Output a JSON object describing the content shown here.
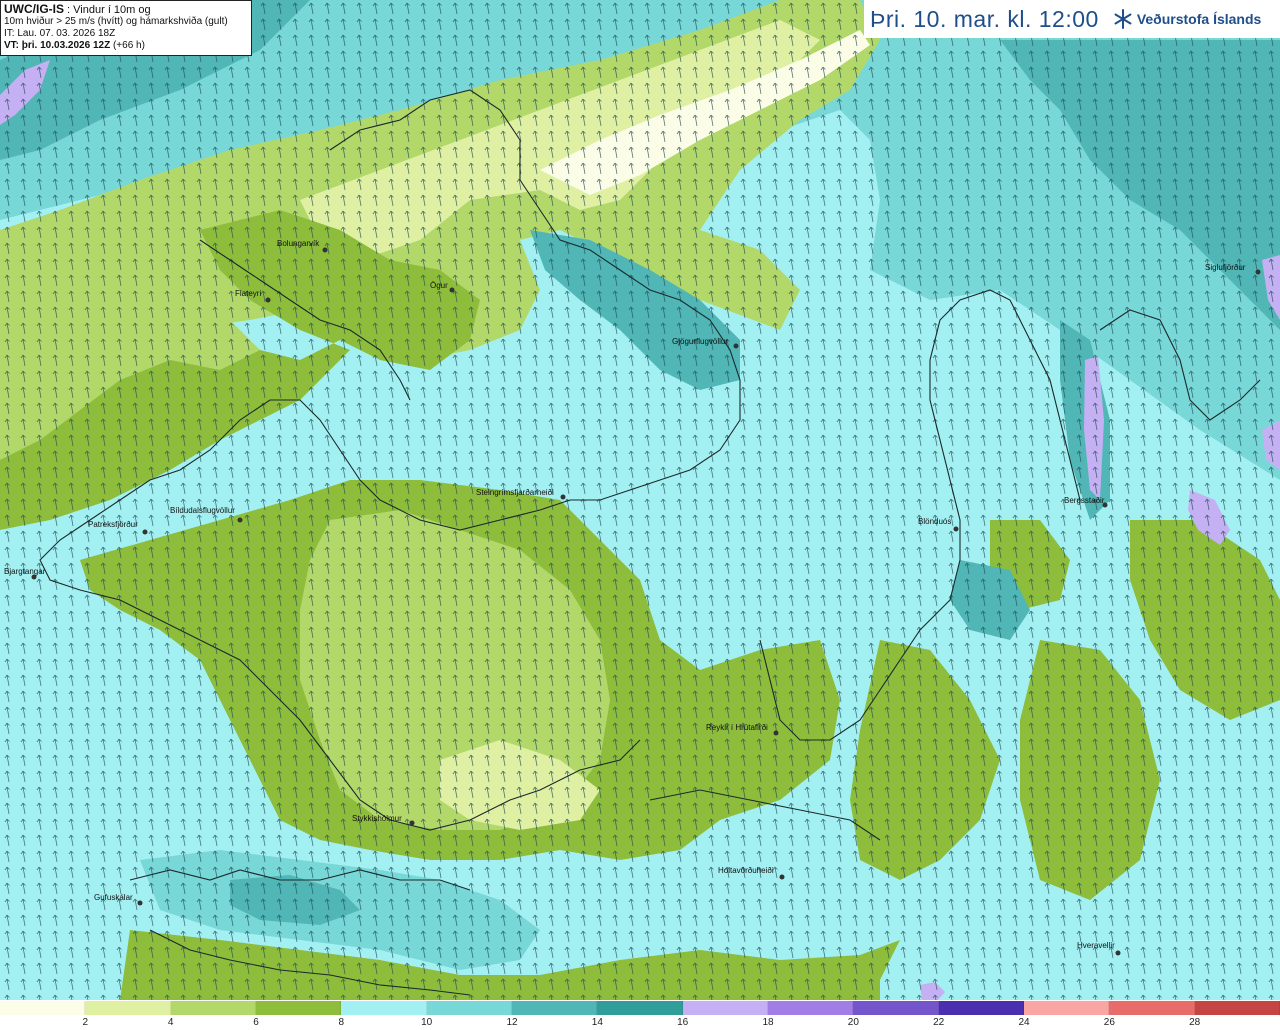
{
  "info": {
    "model": "UWC/IG-IS",
    "line1_rest": " : Vindur í 10m og",
    "line2": "10m hviður > 25 m/s (hvítt) og hámarkshviða (gult)",
    "line3": "IT: Lau. 07. 03. 2026 18Z",
    "line4_label": "VT:",
    "line4_value": "þri. 10.03.2026 12Z",
    "line4_offset": "(+66 h)"
  },
  "header": {
    "valid_time": "Þri. 10. mar. kl. 12:00",
    "logo_text": "Veðurstofa Íslands",
    "logo_icon": "snowflake-icon"
  },
  "legend": {
    "ticks": [
      "2",
      "4",
      "6",
      "8",
      "10",
      "12",
      "14",
      "16",
      "18",
      "20",
      "22",
      "24",
      "26",
      "28"
    ],
    "colors": [
      "#fbfde6",
      "#dff0a3",
      "#b3d86a",
      "#8dbd3a",
      "#a3f0f2",
      "#78d7d7",
      "#50b6b6",
      "#2f9d9a",
      "#c4b0f2",
      "#a07ee6",
      "#7455cc",
      "#4a2fae",
      "#f8a5a3",
      "#e86c6a",
      "#c54444"
    ]
  },
  "places": [
    {
      "name": "Bolungarvík"
    },
    {
      "name": "Flateyri"
    },
    {
      "name": "Ögur"
    },
    {
      "name": "Gjögurflugvöllur"
    },
    {
      "name": "Patreksfjörður"
    },
    {
      "name": "Bíldudalsflugvöllur"
    },
    {
      "name": "Bjargtangar"
    },
    {
      "name": "Steingrímsfjarðarheiði"
    },
    {
      "name": "Blönduós"
    },
    {
      "name": "Bergsstaðir"
    },
    {
      "name": "Siglufjörður"
    },
    {
      "name": "Reykir í Hrútafirði"
    },
    {
      "name": "Stykkishólmur"
    },
    {
      "name": "Holtavörðuheiði"
    },
    {
      "name": "Gufuskálar"
    },
    {
      "name": "Hveravellir"
    }
  ]
}
